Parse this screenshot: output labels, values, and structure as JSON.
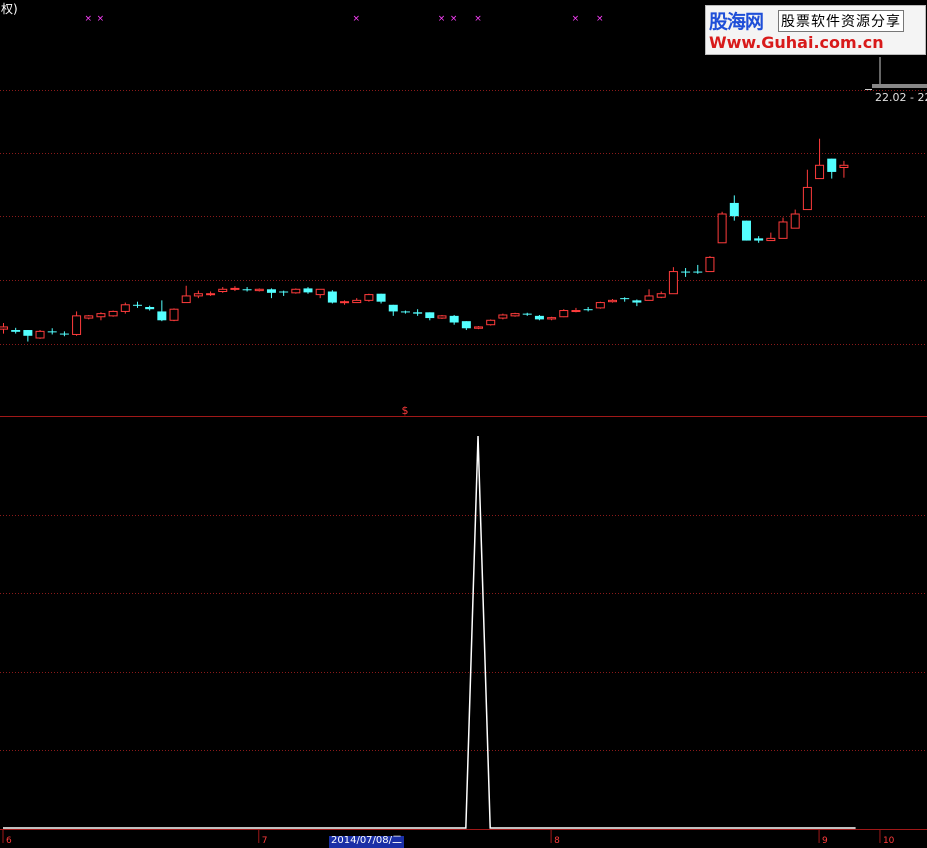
{
  "window": {
    "title_fragment": "权)"
  },
  "watermark": {
    "brand": "股海网",
    "slogan": "股票软件资源分享",
    "url": "Www.Guhai.com.cn"
  },
  "price_label": "22.02 - 22",
  "signal_marker": "$",
  "bottom_axis": {
    "date_box": "2014/07/08/二",
    "ticks": [
      {
        "label": "6",
        "x_bar": 0
      },
      {
        "label": "7",
        "x_bar": 21
      },
      {
        "label": "8",
        "x_bar": 45
      },
      {
        "label": "9",
        "x_bar": 67
      },
      {
        "label": "10",
        "x_bar": 72
      }
    ]
  },
  "colors": {
    "up": "#ff3c3c",
    "down": "#54ffff",
    "grid": "#8b1a1a",
    "indicator": "#ffffff",
    "marker_x": "#ff40ff"
  },
  "chart_data": [
    {
      "type": "candlestick",
      "title": "",
      "price_range": [
        15.5,
        22.5
      ],
      "x_markers": [
        7,
        8,
        29,
        36,
        37,
        39,
        47,
        49
      ],
      "signal_bar": 33,
      "candles": [
        {
          "o": 17.1,
          "c": 17.15,
          "h": 17.24,
          "l": 17.0,
          "up": true
        },
        {
          "o": 17.08,
          "c": 17.04,
          "h": 17.13,
          "l": 17.0,
          "up": false
        },
        {
          "o": 17.08,
          "c": 16.95,
          "h": 17.08,
          "l": 16.82,
          "up": false
        },
        {
          "o": 16.9,
          "c": 17.05,
          "h": 17.08,
          "l": 16.88,
          "up": true
        },
        {
          "o": 17.05,
          "c": 17.05,
          "h": 17.12,
          "l": 16.98,
          "up": false
        },
        {
          "o": 17.0,
          "c": 16.98,
          "h": 17.05,
          "l": 16.94,
          "up": false
        },
        {
          "o": 16.98,
          "c": 17.4,
          "h": 17.5,
          "l": 16.95,
          "up": true
        },
        {
          "o": 17.35,
          "c": 17.4,
          "h": 17.42,
          "l": 17.32,
          "up": true
        },
        {
          "o": 17.38,
          "c": 17.45,
          "h": 17.48,
          "l": 17.3,
          "up": true
        },
        {
          "o": 17.4,
          "c": 17.5,
          "h": 17.52,
          "l": 17.38,
          "up": true
        },
        {
          "o": 17.5,
          "c": 17.65,
          "h": 17.7,
          "l": 17.45,
          "up": true
        },
        {
          "o": 17.65,
          "c": 17.63,
          "h": 17.72,
          "l": 17.58,
          "up": false
        },
        {
          "o": 17.6,
          "c": 17.55,
          "h": 17.63,
          "l": 17.52,
          "up": false
        },
        {
          "o": 17.5,
          "c": 17.3,
          "h": 17.75,
          "l": 17.28,
          "up": false
        },
        {
          "o": 17.3,
          "c": 17.55,
          "h": 17.57,
          "l": 17.28,
          "up": true
        },
        {
          "o": 17.7,
          "c": 17.85,
          "h": 18.08,
          "l": 17.7,
          "up": true
        },
        {
          "o": 17.85,
          "c": 17.9,
          "h": 17.97,
          "l": 17.8,
          "up": true
        },
        {
          "o": 17.9,
          "c": 17.9,
          "h": 17.95,
          "l": 17.85,
          "up": true
        },
        {
          "o": 17.95,
          "c": 18.0,
          "h": 18.05,
          "l": 17.92,
          "up": true
        },
        {
          "o": 18.0,
          "c": 18.02,
          "h": 18.07,
          "l": 17.96,
          "up": true
        },
        {
          "o": 18.0,
          "c": 17.98,
          "h": 18.05,
          "l": 17.95,
          "up": false
        },
        {
          "o": 17.97,
          "c": 18.0,
          "h": 18.02,
          "l": 17.95,
          "up": true
        },
        {
          "o": 18.0,
          "c": 17.92,
          "h": 18.02,
          "l": 17.8,
          "up": false
        },
        {
          "o": 17.95,
          "c": 17.95,
          "h": 17.97,
          "l": 17.85,
          "up": false
        },
        {
          "o": 17.92,
          "c": 18.0,
          "h": 18.02,
          "l": 17.9,
          "up": true
        },
        {
          "o": 18.02,
          "c": 17.93,
          "h": 18.05,
          "l": 17.9,
          "up": false
        },
        {
          "o": 18.0,
          "c": 17.88,
          "h": 18.0,
          "l": 17.8,
          "up": true
        },
        {
          "o": 17.95,
          "c": 17.7,
          "h": 17.98,
          "l": 17.68,
          "up": false
        },
        {
          "o": 17.72,
          "c": 17.72,
          "h": 17.75,
          "l": 17.65,
          "up": true
        },
        {
          "o": 17.7,
          "c": 17.75,
          "h": 17.8,
          "l": 17.7,
          "up": true
        },
        {
          "o": 17.75,
          "c": 17.88,
          "h": 17.9,
          "l": 17.72,
          "up": true
        },
        {
          "o": 17.9,
          "c": 17.72,
          "h": 17.9,
          "l": 17.68,
          "up": false
        },
        {
          "o": 17.65,
          "c": 17.5,
          "h": 17.65,
          "l": 17.4,
          "up": false
        },
        {
          "o": 17.5,
          "c": 17.48,
          "h": 17.52,
          "l": 17.45,
          "up": false
        },
        {
          "o": 17.48,
          "c": 17.45,
          "h": 17.55,
          "l": 17.4,
          "up": false
        },
        {
          "o": 17.48,
          "c": 17.35,
          "h": 17.48,
          "l": 17.3,
          "up": false
        },
        {
          "o": 17.35,
          "c": 17.4,
          "h": 17.42,
          "l": 17.33,
          "up": true
        },
        {
          "o": 17.4,
          "c": 17.25,
          "h": 17.42,
          "l": 17.2,
          "up": false
        },
        {
          "o": 17.28,
          "c": 17.12,
          "h": 17.28,
          "l": 17.08,
          "up": false
        },
        {
          "o": 17.12,
          "c": 17.15,
          "h": 17.17,
          "l": 17.1,
          "up": true
        },
        {
          "o": 17.2,
          "c": 17.3,
          "h": 17.32,
          "l": 17.18,
          "up": true
        },
        {
          "o": 17.35,
          "c": 17.42,
          "h": 17.45,
          "l": 17.32,
          "up": true
        },
        {
          "o": 17.4,
          "c": 17.45,
          "h": 17.47,
          "l": 17.38,
          "up": true
        },
        {
          "o": 17.45,
          "c": 17.43,
          "h": 17.47,
          "l": 17.4,
          "up": false
        },
        {
          "o": 17.4,
          "c": 17.32,
          "h": 17.42,
          "l": 17.3,
          "up": false
        },
        {
          "o": 17.33,
          "c": 17.36,
          "h": 17.38,
          "l": 17.3,
          "up": true
        },
        {
          "o": 17.38,
          "c": 17.52,
          "h": 17.55,
          "l": 17.37,
          "up": true
        },
        {
          "o": 17.5,
          "c": 17.52,
          "h": 17.58,
          "l": 17.48,
          "up": true
        },
        {
          "o": 17.55,
          "c": 17.55,
          "h": 17.6,
          "l": 17.5,
          "up": false
        },
        {
          "o": 17.58,
          "c": 17.7,
          "h": 17.72,
          "l": 17.56,
          "up": true
        },
        {
          "o": 17.72,
          "c": 17.75,
          "h": 17.78,
          "l": 17.7,
          "up": true
        },
        {
          "o": 17.8,
          "c": 17.78,
          "h": 17.82,
          "l": 17.72,
          "up": false
        },
        {
          "o": 17.75,
          "c": 17.7,
          "h": 17.77,
          "l": 17.62,
          "up": false
        },
        {
          "o": 17.75,
          "c": 17.85,
          "h": 18.0,
          "l": 17.75,
          "up": true
        },
        {
          "o": 17.82,
          "c": 17.9,
          "h": 17.95,
          "l": 17.8,
          "up": true
        },
        {
          "o": 17.9,
          "c": 18.4,
          "h": 18.5,
          "l": 17.9,
          "up": true
        },
        {
          "o": 18.38,
          "c": 18.4,
          "h": 18.48,
          "l": 18.28,
          "up": false
        },
        {
          "o": 18.4,
          "c": 18.4,
          "h": 18.55,
          "l": 18.35,
          "up": false
        },
        {
          "o": 18.4,
          "c": 18.72,
          "h": 18.75,
          "l": 18.4,
          "up": true
        },
        {
          "o": 19.05,
          "c": 19.7,
          "h": 19.75,
          "l": 19.05,
          "up": true
        },
        {
          "o": 19.65,
          "c": 19.95,
          "h": 20.12,
          "l": 19.55,
          "up": false
        },
        {
          "o": 19.55,
          "c": 19.1,
          "h": 19.55,
          "l": 19.1,
          "up": false
        },
        {
          "o": 19.15,
          "c": 19.1,
          "h": 19.2,
          "l": 19.05,
          "up": false
        },
        {
          "o": 19.1,
          "c": 19.15,
          "h": 19.28,
          "l": 19.1,
          "up": true
        },
        {
          "o": 19.15,
          "c": 19.52,
          "h": 19.62,
          "l": 19.15,
          "up": true
        },
        {
          "o": 19.38,
          "c": 19.7,
          "h": 19.8,
          "l": 19.38,
          "up": true
        },
        {
          "o": 19.8,
          "c": 20.3,
          "h": 20.7,
          "l": 19.8,
          "up": true
        },
        {
          "o": 20.5,
          "c": 20.8,
          "h": 21.4,
          "l": 20.5,
          "up": true
        },
        {
          "o": 20.95,
          "c": 20.65,
          "h": 20.95,
          "l": 20.5,
          "up": false
        },
        {
          "o": 20.75,
          "c": 20.8,
          "h": 20.9,
          "l": 20.52,
          "up": true
        }
      ]
    },
    {
      "type": "line",
      "title": "",
      "y_range": [
        0,
        1
      ],
      "values": [
        0,
        0,
        0,
        0,
        0,
        0,
        0,
        0,
        0,
        0,
        0,
        0,
        0,
        0,
        0,
        0,
        0,
        0,
        0,
        0,
        0,
        0,
        0,
        0,
        0,
        0,
        0,
        0,
        0,
        0,
        0,
        0,
        0,
        0,
        0,
        0,
        0,
        0,
        0,
        1,
        0,
        0,
        0,
        0,
        0,
        0,
        0,
        0,
        0,
        0,
        0,
        0,
        0,
        0,
        0,
        0,
        0,
        0,
        0,
        0,
        0,
        0,
        0,
        0,
        0,
        0,
        0,
        0,
        0,
        0,
        0
      ]
    }
  ]
}
